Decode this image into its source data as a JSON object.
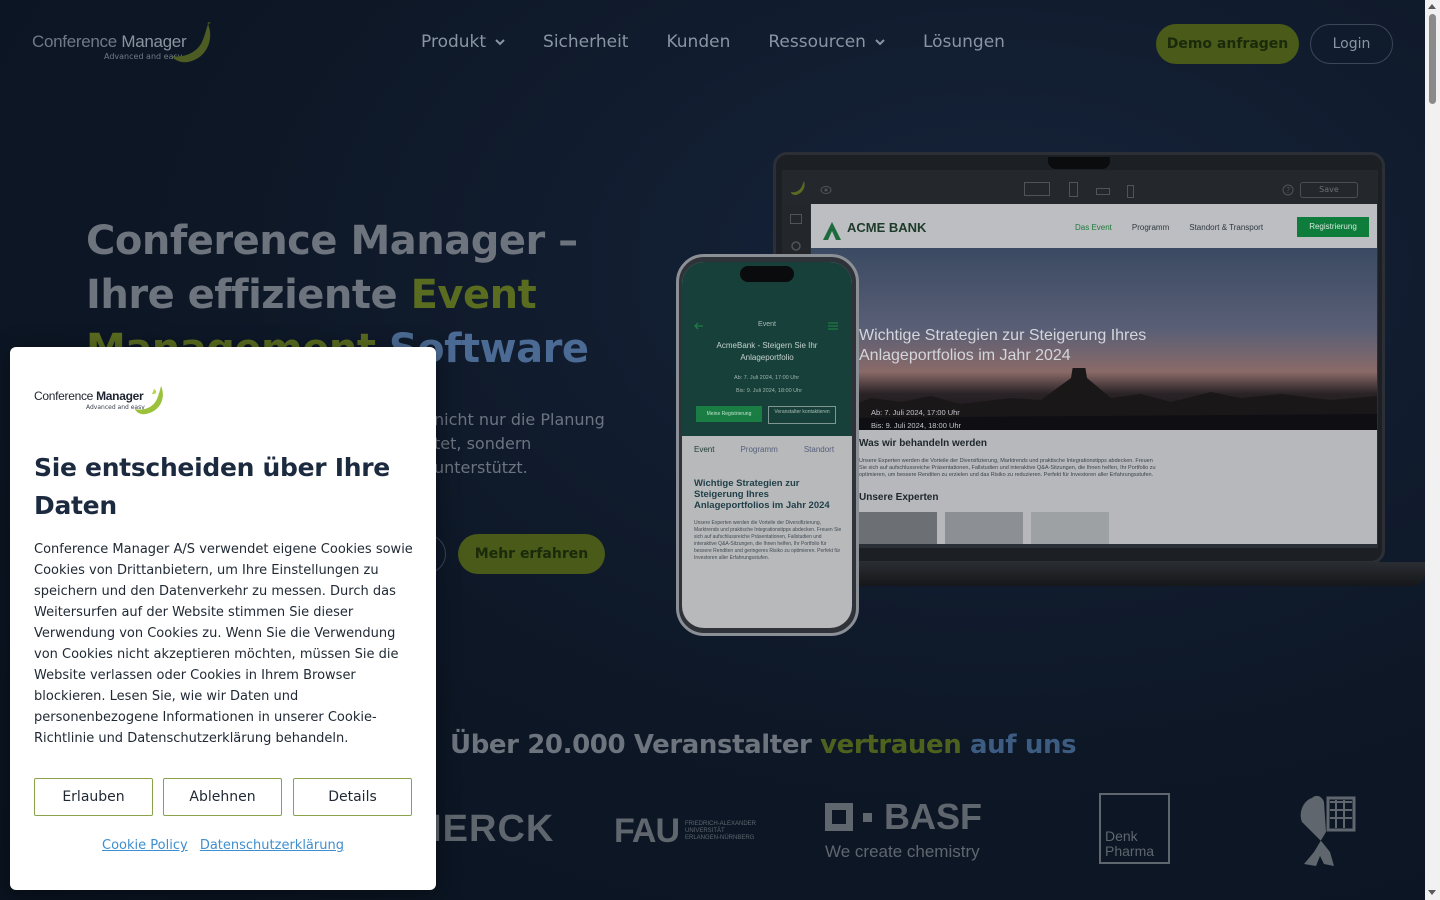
{
  "header": {
    "logo": {
      "word1": "Conference",
      "word2": "Manager",
      "tagline": "Advanced and easy"
    },
    "nav": [
      {
        "label": "Produkt",
        "dropdown": true
      },
      {
        "label": "Sicherheit",
        "dropdown": false
      },
      {
        "label": "Kunden",
        "dropdown": false
      },
      {
        "label": "Ressourcen",
        "dropdown": true
      },
      {
        "label": "Lösungen",
        "dropdown": false
      }
    ],
    "demo_label": "Demo anfragen",
    "login_label": "Login"
  },
  "hero": {
    "title_line1": "Conference Manager –",
    "title_line2_a": "Ihre effiziente ",
    "title_line2_b": "Event",
    "title_line3_a": "Management ",
    "title_line3_b": "Software",
    "text": "nicht nur die Planung\ntet, sondern\nunterstützt.",
    "more_label": "Mehr erfahren"
  },
  "laptop_mock": {
    "save": "Save",
    "brand": "ACME BANK",
    "links": [
      "Das Event",
      "Programm",
      "Standort & Transport"
    ],
    "register": "Registrierung",
    "headline": "Wichtige Strategien zur Steigerung Ihres Anlageportfolios im Jahr 2024",
    "date_from": "Ab: 7. Juli 2024, 17:00 Uhr",
    "date_to": "Bis: 9. Juli 2024, 18:00 Uhr",
    "section1": "Was wir behandeln werden",
    "paragraph": "Unsere Experten werden die Vorteile der Diversifizierung, Marktrends und praktische Integrationstipps abdecken. Freuen Sie sich auf aufschlussreiche Präsentationen, Fallstudien und interaktive Q&A-Sitzungen, die Ihnen helfen, Ihr Portfolio zu optimieren, um bessere Renditen zu erzielen und das Risiko zu reduzieren. Perfekt für Investoren aller Erfahrungsstufen.",
    "section2": "Unsere Experten"
  },
  "phone_mock": {
    "header": "Event",
    "title": "AcmeBank - Steigern Sie Ihr Anlageportfolio",
    "date_from": "Ab: 7. Juli 2024, 17:00 Uhr",
    "date_to": "Bis: 9. Juli 2024, 18:00 Uhr",
    "btn_register": "Meine Registrierung",
    "btn_contact": "Veranstalter kontaktieren",
    "tabs": [
      "Event",
      "Programm",
      "Standort"
    ],
    "headline": "Wichtige Strategien zur Steigerung Ihres Anlageportfolios im Jahr 2024",
    "paragraph": "Unsere Experten werden die Vorteile der Diversifizierung, Marktrends und praktische Integrationstipps abdecken. Freuen Sie sich auf aufschlussreiche Präsentationen, Fallstudien und interaktive Q&A-Sitzungen, die Ihnen helfen, Ihr Portfolio für bessere Renditen und geringeres Risiko zu optimieren. Perfekt für Investoren aller Erfahrungsstufen."
  },
  "trust": {
    "text_a": "Über 20.000 Veranstalter ",
    "text_b": "vertrauen ",
    "text_c": "auf uns"
  },
  "client_logos": {
    "merck": "MERCK",
    "fau_big": "FAU",
    "fau_small": "FRIEDRICH-ALEXANDER\nUNIVERSITÄT\nERLANGEN-NÜRNBERG",
    "basf": "BASF",
    "basf_tagline": "We create chemistry",
    "denk": "Denk\nPharma"
  },
  "cookie": {
    "logo": {
      "word1": "Conference",
      "word2": "Manager",
      "tagline": "Advanced and easy"
    },
    "title": "Sie entscheiden über Ihre Daten",
    "text": "Conference Manager A/S verwendet eigene Cookies sowie Cookies von Drittanbietern, um Ihre Einstellungen zu speichern und den Datenverkehr zu messen. Durch das Weitersurfen auf der Website stimmen Sie dieser Verwendung von Cookies zu. Wenn Sie die Verwendung von Cookies nicht akzeptieren möchten, müssen Sie die Website verlassen oder Cookies in Ihrem Browser blockieren. Lesen Sie, wie wir Daten und personenbezogene Informationen in unserer Cookie-Richtlinie und Datenschutzerklärung behandeln.",
    "allow": "Erlauben",
    "deny": "Ablehnen",
    "details": "Details",
    "link_policy": "Cookie Policy",
    "link_privacy": "Datenschutzerklärung"
  },
  "colors": {
    "accent_green": "#8aa24a",
    "link_blue": "#3f8ecf",
    "bg_dark": "#0d1726"
  }
}
